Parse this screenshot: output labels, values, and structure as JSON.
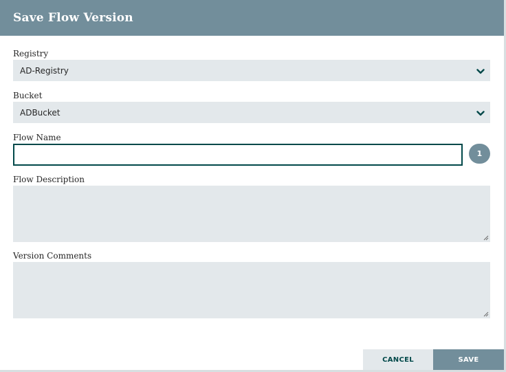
{
  "dialog": {
    "title": "Save Flow Version"
  },
  "form": {
    "registry": {
      "label": "Registry",
      "value": "AD-Registry"
    },
    "bucket": {
      "label": "Bucket",
      "value": "ADBucket"
    },
    "flow_name": {
      "label": "Flow Name",
      "value": "",
      "badge": "1"
    },
    "flow_description": {
      "label": "Flow Description",
      "value": ""
    },
    "version_comments": {
      "label": "Version Comments",
      "value": ""
    }
  },
  "footer": {
    "cancel_label": "CANCEL",
    "save_label": "SAVE"
  },
  "colors": {
    "header": "#728e9b",
    "field_bg": "#e3e8eb",
    "input_border": "#004849",
    "cancel_text": "#004849"
  },
  "icons": {
    "select_arrow": "chevron-down-icon",
    "textarea_grip": "resize-grip-icon"
  }
}
